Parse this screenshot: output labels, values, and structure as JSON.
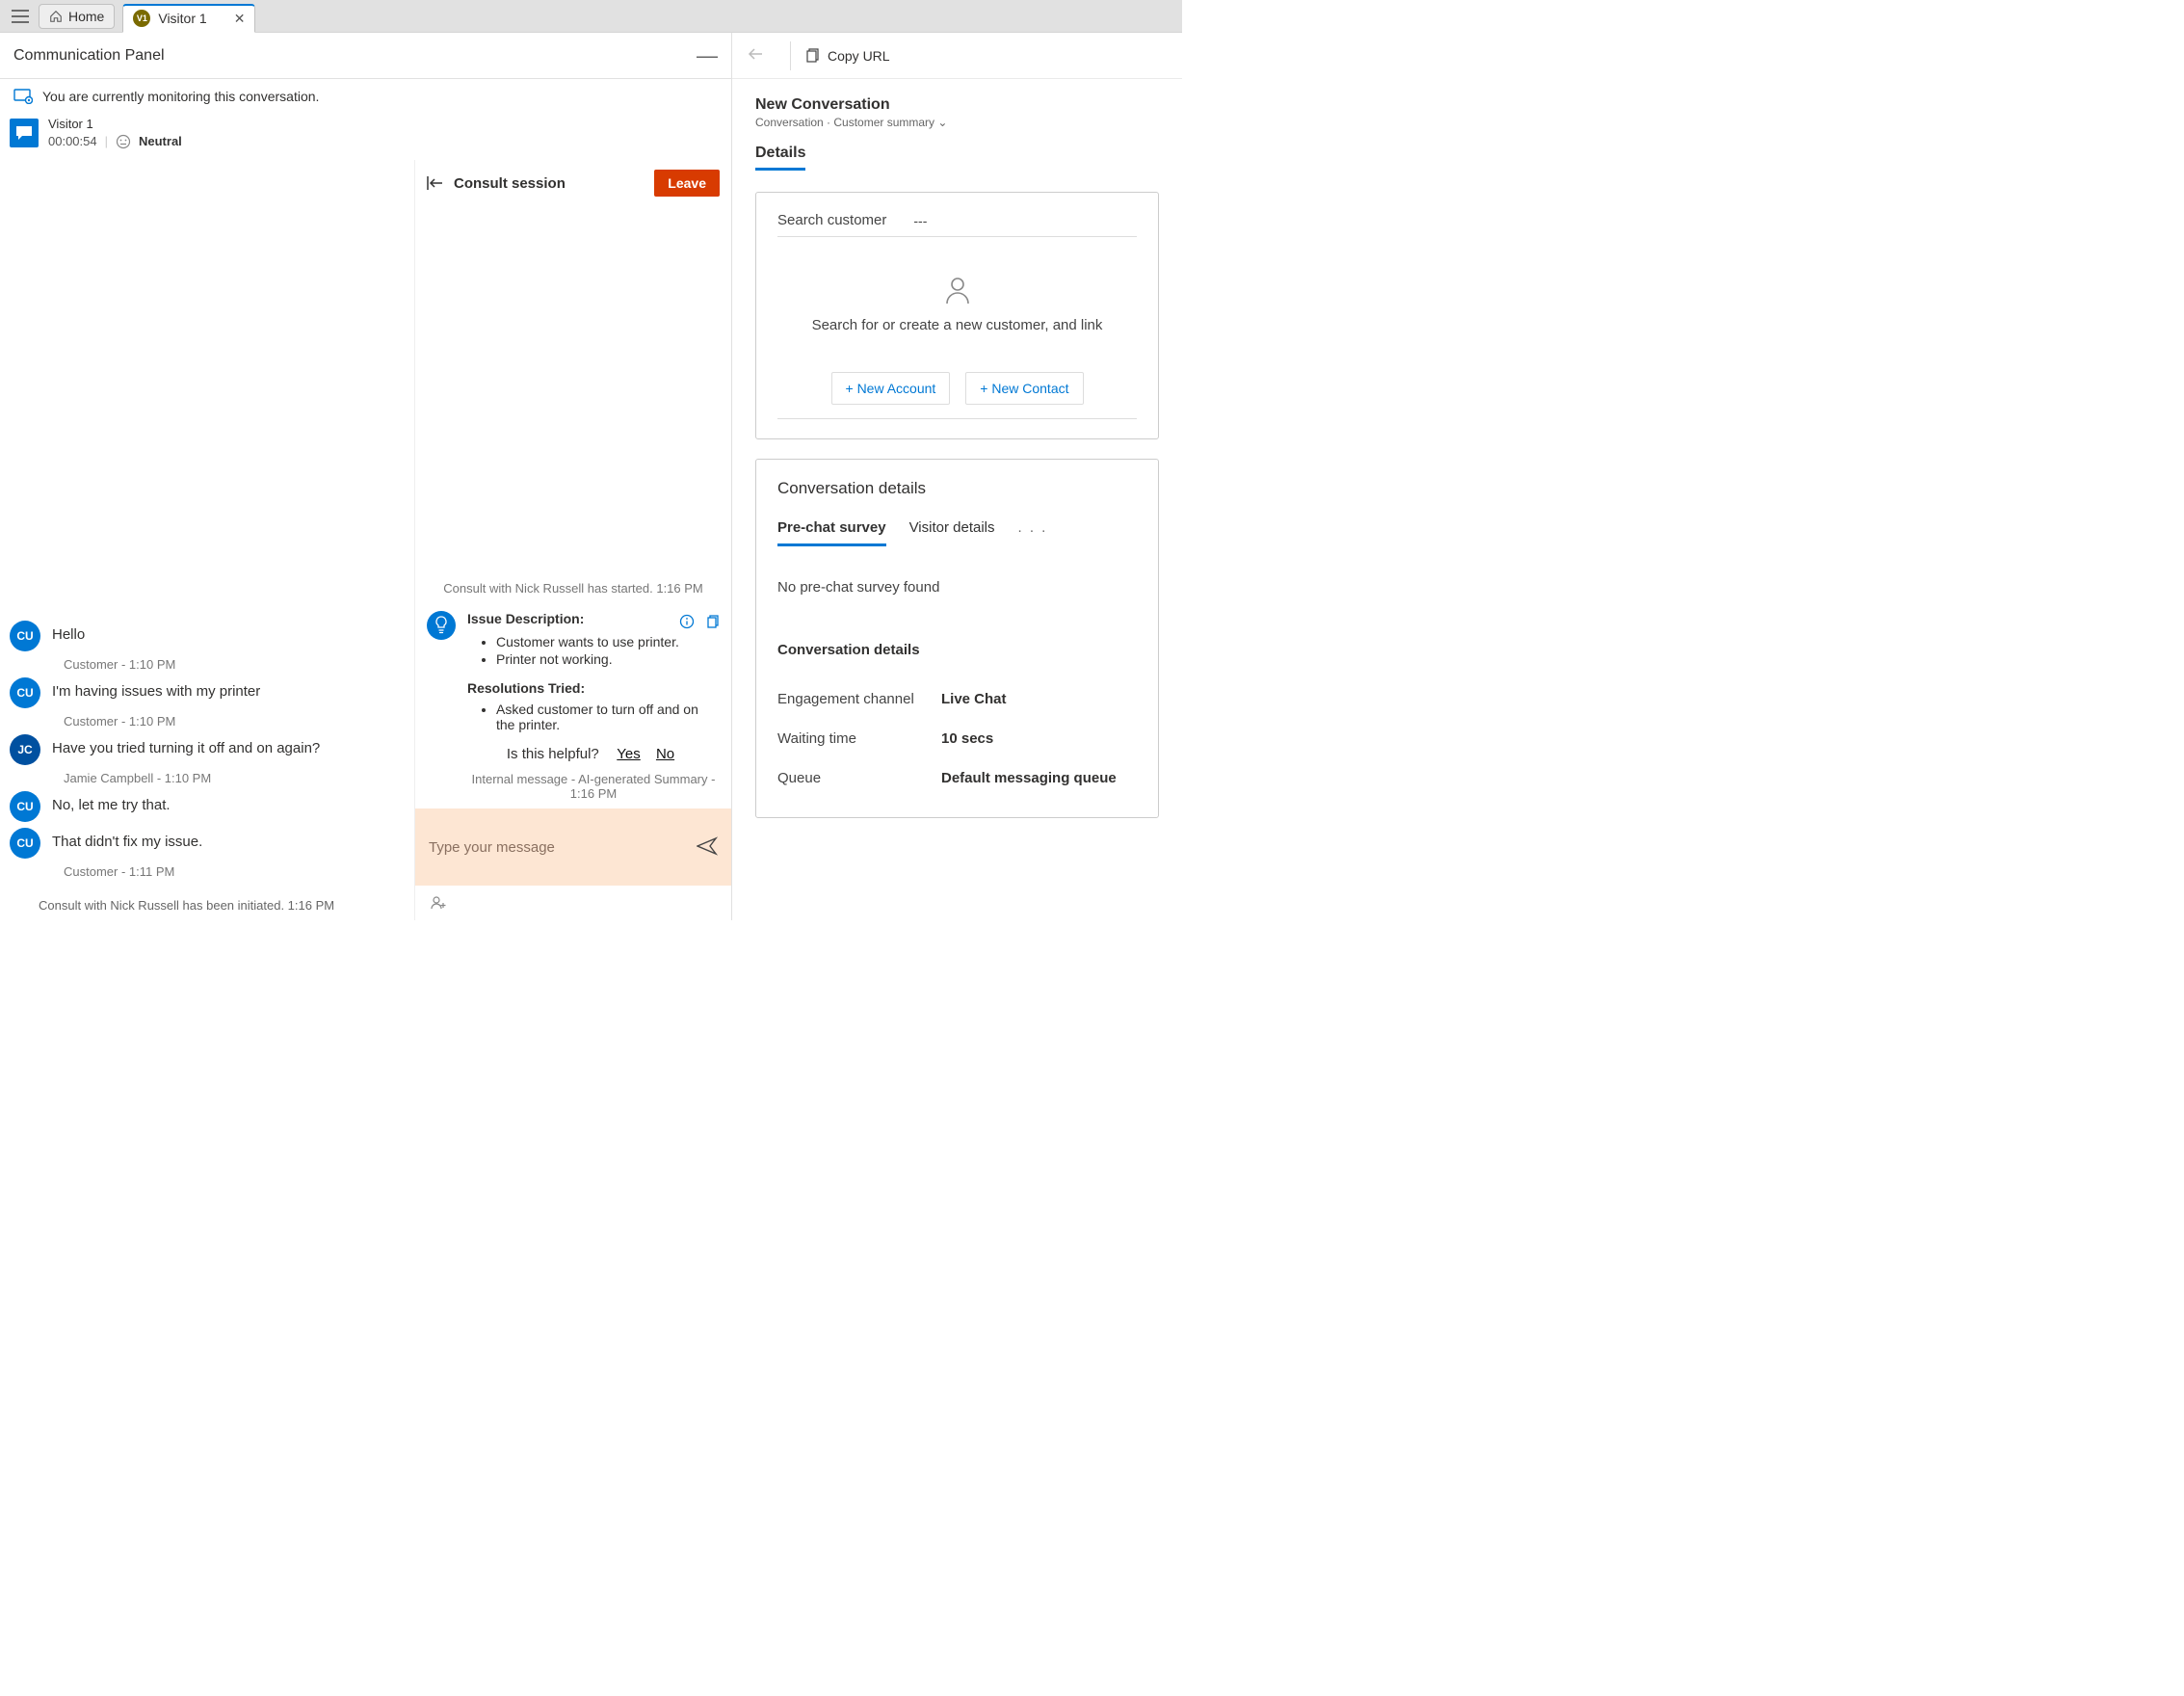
{
  "topbar": {
    "home_label": "Home",
    "visitor_tab": {
      "avatar": "V1",
      "label": "Visitor 1"
    }
  },
  "comm_panel": {
    "title": "Communication Panel"
  },
  "monitor": {
    "text": "You are currently monitoring this conversation."
  },
  "session": {
    "name": "Visitor 1",
    "timer": "00:00:54",
    "sentiment": "Neutral"
  },
  "chat": {
    "messages": [
      {
        "initials": "CU",
        "avatar_class": "cu",
        "text": "Hello",
        "meta": "Customer - 1:10 PM"
      },
      {
        "initials": "CU",
        "avatar_class": "cu",
        "text": "I'm having issues with my printer",
        "meta": "Customer - 1:10 PM"
      },
      {
        "initials": "JC",
        "avatar_class": "jc",
        "text": "Have you tried turning it off and on again?",
        "meta": "Jamie Campbell - 1:10 PM"
      },
      {
        "initials": "CU",
        "avatar_class": "cu",
        "text": "No, let me try that.",
        "meta": ""
      },
      {
        "initials": "CU",
        "avatar_class": "cu",
        "text": "That didn't fix my issue.",
        "meta": "Customer - 1:11 PM"
      }
    ],
    "system": "Consult with Nick Russell has been initiated. 1:16 PM"
  },
  "consult": {
    "title": "Consult session",
    "leave": "Leave",
    "started": "Consult with Nick Russell has started. 1:16 PM",
    "summary": {
      "issue_title": "Issue Description:",
      "issues": [
        "Customer wants to use printer.",
        "Printer not working."
      ],
      "resolutions_title": "Resolutions Tried:",
      "resolutions": [
        "Asked customer to turn off and on the printer."
      ],
      "helpful_q": "Is this helpful?",
      "yes": "Yes",
      "no": "No",
      "internal_meta": "Internal message - AI-generated Summary - 1:16 PM"
    },
    "compose_placeholder": "Type your message"
  },
  "right": {
    "copy_url": "Copy URL",
    "record_title": "New Conversation",
    "record_sub": "Conversation  ·  Customer summary ⌄",
    "details_tab": "Details",
    "search_label": "Search customer",
    "search_value": "---",
    "empty_customer": "Search for or create a new customer, and link",
    "new_account": "+ New Account",
    "new_contact": "+ New Contact",
    "conv_details_title": "Conversation details",
    "tabs": {
      "survey": "Pre-chat survey",
      "visitor": "Visitor details",
      "more": ". . ."
    },
    "empty_survey": "No pre-chat survey found",
    "kv_title": "Conversation details",
    "rows": [
      {
        "k": "Engagement channel",
        "v": "Live Chat"
      },
      {
        "k": "Waiting time",
        "v": "10 secs"
      },
      {
        "k": "Queue",
        "v": "Default messaging queue"
      }
    ]
  }
}
